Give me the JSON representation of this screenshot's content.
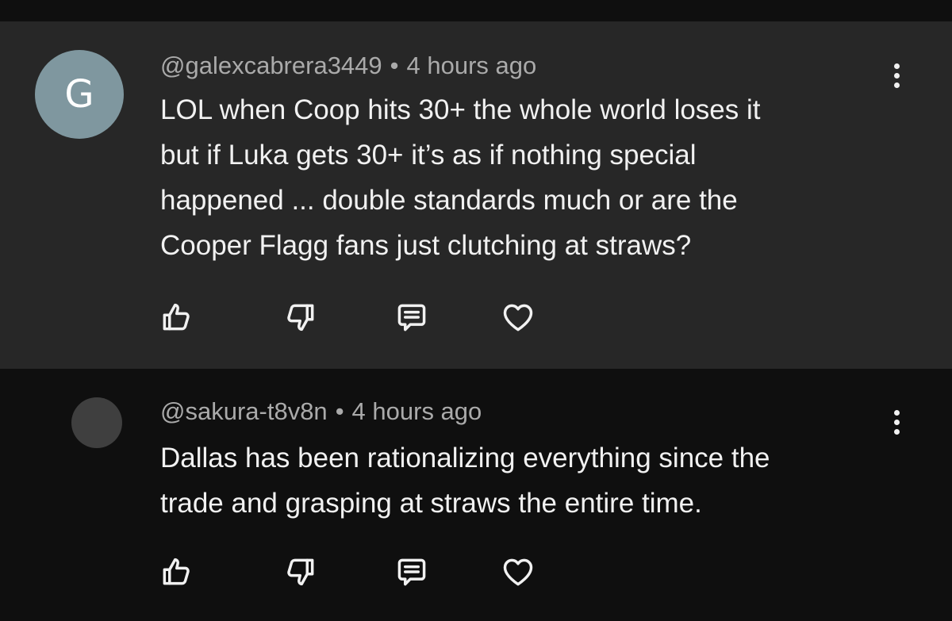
{
  "comments": [
    {
      "avatar_letter": "G",
      "avatar_color": "#7f979f",
      "username": "@galexcabrera3449",
      "separator": "•",
      "time": "4 hours ago",
      "lines": [
        "LOL when Coop hits 30+ the whole world loses it",
        "but if Luka gets 30+ it’s as if nothing special",
        "happened ... double standards much or are the",
        "Cooper Flagg fans just clutching at straws?"
      ],
      "actions": [
        "thumbs-up-icon",
        "thumbs-down-icon",
        "reply-icon",
        "heart-icon"
      ]
    },
    {
      "avatar_letter": "",
      "avatar_color": "#3f3f3f",
      "username": "@sakura-t8v8n",
      "separator": "•",
      "time": "4 hours ago",
      "lines": [
        "Dallas has been rationalizing everything since the",
        "trade and grasping at straws the entire time."
      ],
      "actions": [
        "thumbs-up-icon",
        "thumbs-down-icon",
        "reply-icon",
        "heart-icon"
      ]
    }
  ],
  "colors": {
    "highlight_background": "#272727",
    "page_background": "#0f0f0f",
    "text_primary": "#f1f1f1",
    "text_secondary": "#aaaaaa"
  }
}
